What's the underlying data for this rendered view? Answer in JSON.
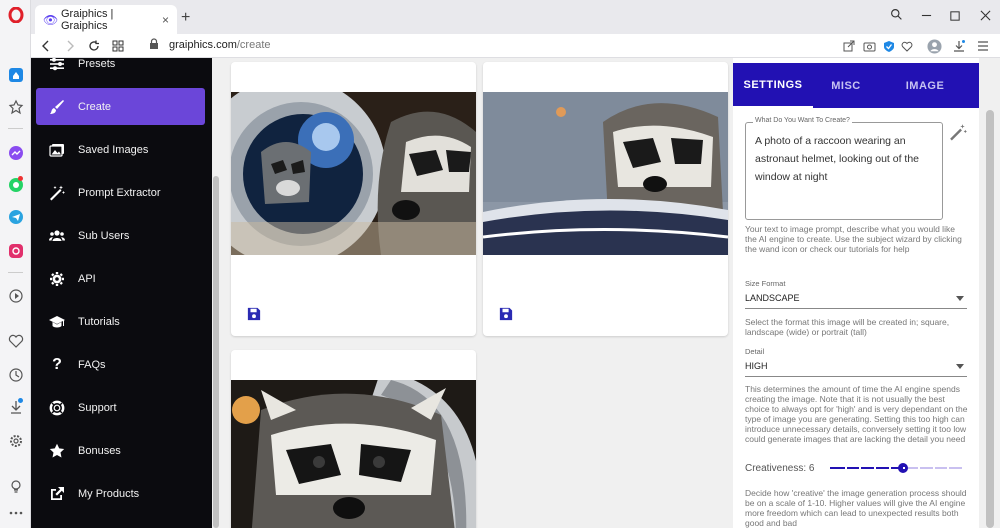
{
  "browser": {
    "tab_title": "Graiphics | Graiphics",
    "url_domain": "graiphics.com",
    "url_path": "/create",
    "new_tab": "+",
    "tab_close": "×"
  },
  "sidebar": {
    "items": [
      {
        "label": "Presets",
        "icon": "sliders-icon"
      },
      {
        "label": "Create",
        "icon": "brush-icon",
        "active": true
      },
      {
        "label": "Saved Images",
        "icon": "images-icon"
      },
      {
        "label": "Prompt Extractor",
        "icon": "magic-wand-icon"
      },
      {
        "label": "Sub Users",
        "icon": "users-icon"
      },
      {
        "label": "API",
        "icon": "gear-icon"
      },
      {
        "label": "Tutorials",
        "icon": "graduation-cap-icon"
      },
      {
        "label": "FAQs",
        "icon": "question-icon"
      },
      {
        "label": "Support",
        "icon": "life-ring-icon"
      },
      {
        "label": "Bonuses",
        "icon": "star-icon"
      },
      {
        "label": "My Products",
        "icon": "external-link-icon"
      }
    ],
    "accent": "#6b46d9"
  },
  "panel": {
    "tabs": [
      {
        "label": "SETTINGS",
        "active": true
      },
      {
        "label": "MISC"
      },
      {
        "label": "IMAGE"
      }
    ],
    "prompt_legend": "What Do You Want To Create?",
    "prompt_value": "A photo of a raccoon wearing an astronaut helmet, looking out of the window at night",
    "prompt_help": "Your text to image prompt, describe what you would like the AI engine to create. Use the subject wizard by clicking the wand icon or check our tutorials for help",
    "size_label": "Size Format",
    "size_value": "LANDSCAPE",
    "size_help": "Select the format this image will be created in; square, landscape (wide) or portrait (tall)",
    "detail_label": "Detail",
    "detail_value": "HIGH",
    "detail_help": "This determines the amount of time the AI engine spends creating the image. Note that it is not usually the best choice to always opt for 'high' and is very dependant on the type of image you are generating. Setting this too high can introduce unnecessary details, conversely setting it too low could generate images that are lacking the detail you need",
    "creativeness_label": "Creativeness: 6",
    "creativeness_value": 6,
    "creativeness_max": 10,
    "creativeness_help": "Decide how 'creative' the image generation process should be on a scale of 1-10. Higher values will give the AI engine more freedom which can lead to unexpected results both good and bad",
    "accent": "#2211b3"
  }
}
